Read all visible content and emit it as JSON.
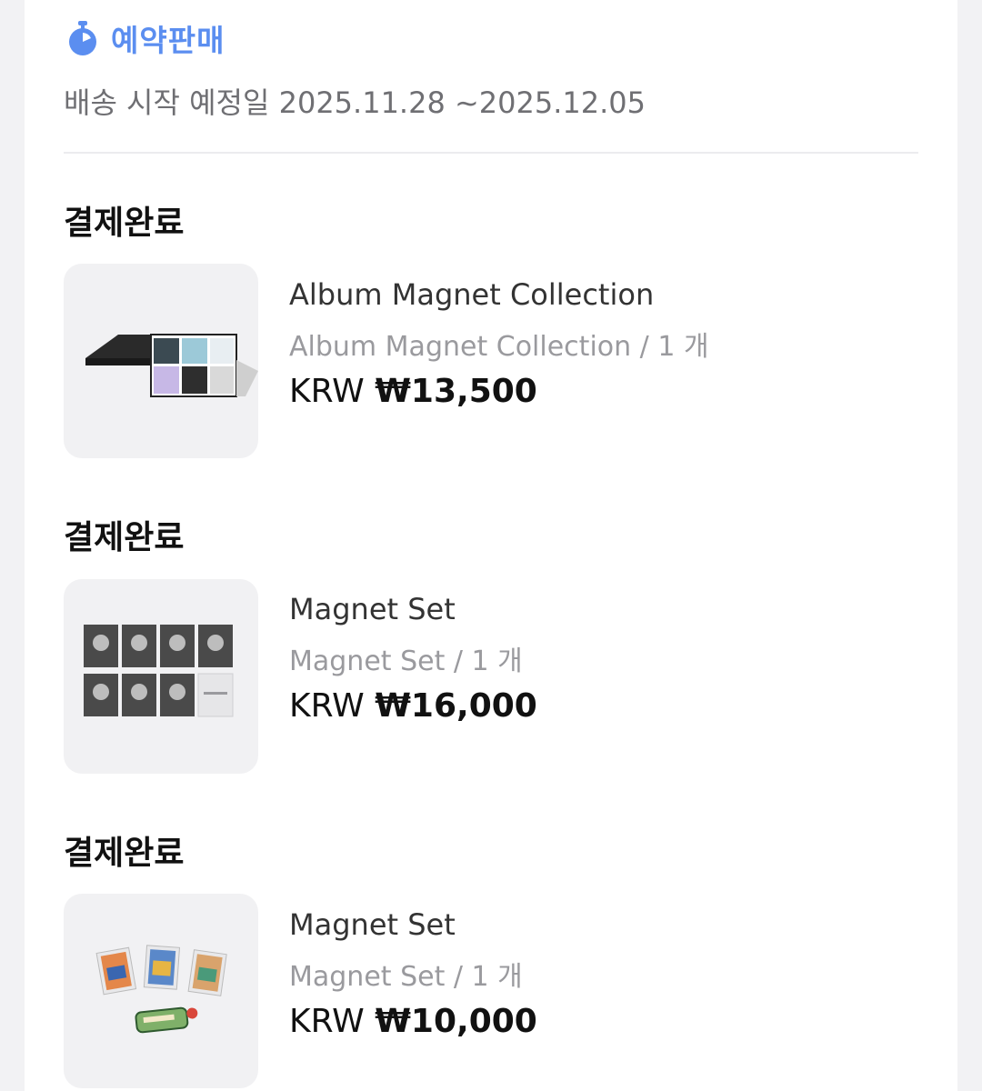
{
  "preorder": {
    "label": "예약판매",
    "icon": "stopwatch-icon",
    "color": "#5b8ef0"
  },
  "shipping": {
    "text": "배송 시작 예정일 2025.11.28 ~2025.12.05"
  },
  "orders": [
    {
      "status": "결제완료",
      "name": "Album Magnet Collection",
      "option": "Album Magnet Collection / 1 개",
      "currency": "KRW",
      "amount": "₩13,500"
    },
    {
      "status": "결제완료",
      "name": "Magnet Set",
      "option": "Magnet Set / 1 개",
      "currency": "KRW",
      "amount": "₩16,000"
    },
    {
      "status": "결제완료",
      "name": "Magnet Set",
      "option": "Magnet Set / 1 개",
      "currency": "KRW",
      "amount": "₩10,000"
    }
  ]
}
